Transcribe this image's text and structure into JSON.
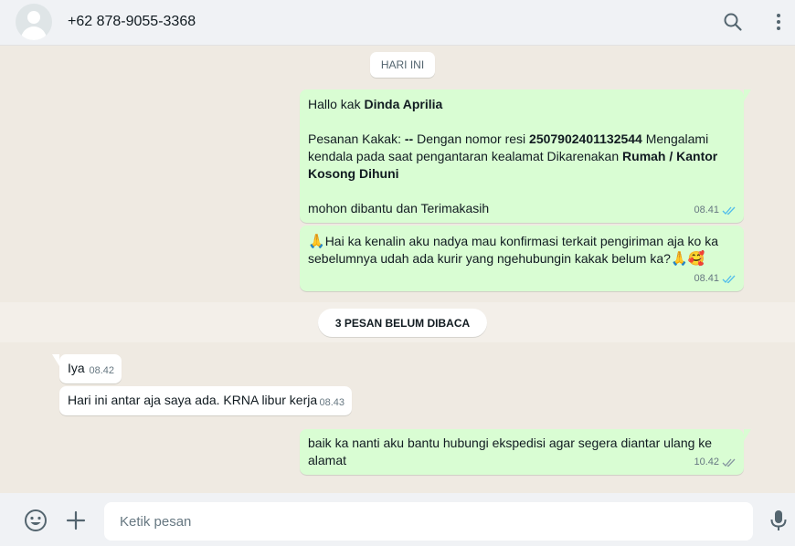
{
  "header": {
    "contact_name": "+62 878-9055-3368",
    "icons": [
      "avatar",
      "search-icon",
      "menu-icon"
    ]
  },
  "chat": {
    "date_label": "HARI INI",
    "unread_label": "3 PESAN BELUM DIBACA",
    "messages": [
      {
        "direction": "out",
        "greeting_prefix": "Hallo kak ",
        "greeting_name": "Dinda Aprilia",
        "line2_a": "Pesanan Kakak: ",
        "line2_b": "--",
        "line2_c": " Dengan nomor resi ",
        "line2_resi": "2507902401132544",
        "line2_d": " Mengalami kendala pada saat pengantaran kealamat Dikarenakan ",
        "line2_reason": "Rumah / Kantor Kosong Dihuni",
        "closing": " mohon dibantu dan Terimakasih",
        "time": "08.41"
      },
      {
        "direction": "out",
        "text_a": "Hai ka kenalin aku nadya mau konfirmasi terkait pengiriman aja ko ka sebelumnya udah ada kurir yang ngehubungin kakak belum ka?",
        "emoji_pray": "🙏",
        "emoji_love": "🥰",
        "time": "08.41"
      },
      {
        "direction": "in",
        "text": "Iya",
        "time": "08.42"
      },
      {
        "direction": "in",
        "text": "Hari ini antar aja saya ada. KRNA libur kerja",
        "time": "08.43"
      },
      {
        "direction": "out",
        "text": "baik ka nanti aku bantu hubungi ekspedisi agar segera diantar ulang ke alamat",
        "time": "10.42"
      }
    ]
  },
  "footer": {
    "input_placeholder": "Ketik pesan",
    "input_value": ""
  },
  "colors": {
    "outgoing_bubble": "#d9fdd3",
    "incoming_bubble": "#ffffff",
    "chat_background": "#efeae2",
    "read_ticks": "#53bdeb"
  }
}
